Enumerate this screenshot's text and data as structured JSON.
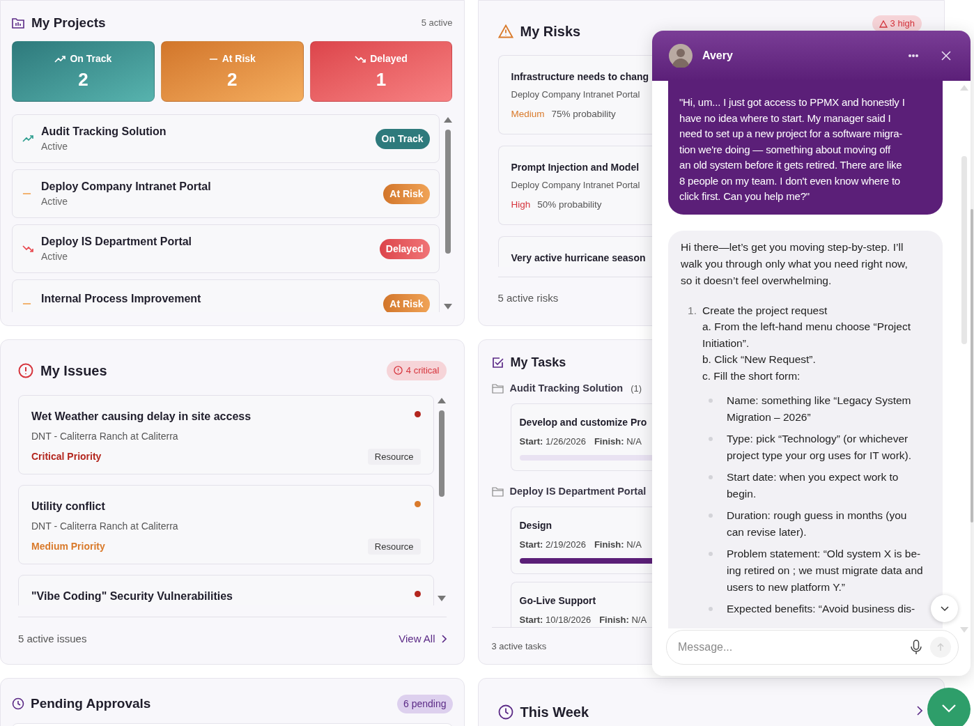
{
  "projects": {
    "title": "My Projects",
    "count": "5 active",
    "summary": [
      {
        "kind": "on_track",
        "label": "On Track",
        "value": "2"
      },
      {
        "kind": "at_risk",
        "label": "At Risk",
        "value": "2"
      },
      {
        "kind": "delayed",
        "label": "Delayed",
        "value": "1"
      }
    ],
    "items": [
      {
        "name": "Audit Tracking Solution",
        "status": "Active",
        "kind": "on_track",
        "badge": "On Track"
      },
      {
        "name": "Deploy Company Intranet Portal",
        "status": "Active",
        "kind": "at_risk",
        "badge": "At Risk"
      },
      {
        "name": "Deploy IS Department Portal",
        "status": "Active",
        "kind": "delayed",
        "badge": "Delayed"
      },
      {
        "name": "Internal Process Improvement",
        "kind": "at_risk",
        "badge": "At Risk"
      }
    ]
  },
  "issues": {
    "title": "My Issues",
    "badge": "4 critical",
    "items": [
      {
        "title": "Wet Weather causing delay in site access",
        "project": "DNT - Caliterra Ranch at Caliterra",
        "priority": "Critical Priority",
        "kind": "critical",
        "tag": "Resource",
        "color": "#b3261e"
      },
      {
        "title": "Utility conflict",
        "project": "DNT - Caliterra Ranch at Caliterra",
        "priority": "Medium Priority",
        "kind": "medium",
        "tag": "Resource",
        "color": "#d97a2b"
      },
      {
        "title": "\"Vibe Coding\" Security Vulnerabilities",
        "color": "#b3261e"
      }
    ],
    "footer": "5 active issues",
    "link": "View All"
  },
  "approvals": {
    "title": "Pending Approvals",
    "badge": "6 pending"
  },
  "risks": {
    "title": "My Risks",
    "badge": "3 high",
    "items": [
      {
        "title": "Infrastructure needs to chang",
        "project": "Deploy Company Intranet Portal",
        "level_text": "Medium",
        "kind": "medium",
        "probability": "75% probability"
      },
      {
        "title": "Prompt Injection and Model",
        "project": "Deploy Company Intranet Portal",
        "level_text": "High",
        "kind": "high",
        "probability": "50% probability"
      },
      {
        "title": "Very active hurricane season"
      }
    ],
    "footer": "5 active risks"
  },
  "tasks": {
    "title": "My Tasks",
    "groups": [
      {
        "name": "Audit Tracking Solution",
        "count": "(1)",
        "tasks": [
          {
            "name": "Develop and customize Pro",
            "start_label": "Start:",
            "start": "1/26/2026",
            "finish_label": "Finish:",
            "finish": "N/A",
            "bar_filled": false
          }
        ]
      },
      {
        "name": "Deploy IS Department Portal",
        "tasks": [
          {
            "name": "Design",
            "start_label": "Start:",
            "start": "2/19/2026",
            "finish_label": "Finish:",
            "finish": "N/A",
            "bar_filled": true
          },
          {
            "name": "Go-Live Support",
            "start_label": "Start:",
            "start": "10/18/2026",
            "finish_label": "Finish:",
            "finish": "N/A"
          }
        ]
      }
    ],
    "footer": "3 active tasks"
  },
  "this_week": {
    "title": "This Week"
  },
  "chat": {
    "name": "Avery",
    "user_message_lines": [
      "\"Hi, um... I just got access to PPMX and honestly I",
      "have no idea where to start. My manager said I",
      "need to set up a new project for a software migra-",
      "tion we're doing — something about moving off",
      "an old system before it gets retired. There are like",
      "8 people on my team. I don't even know where to",
      "click first. Can you help me?\""
    ],
    "assistant": {
      "intro_lines": [
        "Hi there—let’s get you moving step-by-step. I’ll",
        "walk you through only what you need right now,",
        "so it doesn’t feel overwhelming."
      ],
      "steps": [
        {
          "number": "1.",
          "lines": [
            "Create the project request",
            "a. From the left-hand menu choose “Project",
            "Initiation”.",
            "b. Click “New Request”.",
            "c. Fill the short form:"
          ],
          "bullets": [
            [
              "Name: something like “Legacy System",
              "Migration – 2026”"
            ],
            [
              "Type: pick “Technology” (or whichever",
              "project type your org uses for IT work)."
            ],
            [
              "Start date: when you expect work to",
              "begin."
            ],
            [
              "Duration: rough guess in months (you",
              "can revise later)."
            ],
            [
              "Problem statement: “Old system X is be-",
              "ing retired on ; we must migrate data and",
              "users to new platform Y.”"
            ],
            [
              "Expected benefits: “Avoid business dis-"
            ]
          ]
        }
      ]
    },
    "input": {
      "placeholder": "Message..."
    }
  }
}
